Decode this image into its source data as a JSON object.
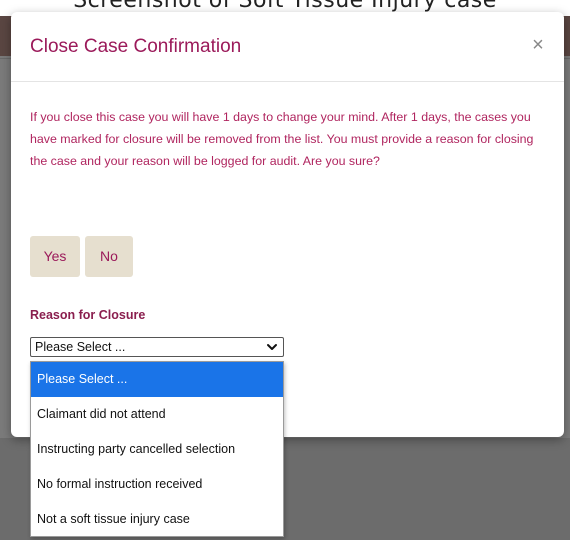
{
  "background": {
    "caption": "Screenshot of Soft Tissue Injury case"
  },
  "modal": {
    "title": "Close Case Confirmation",
    "close_symbol": "×",
    "message": "If you close this case you will have 1 days to change your mind. After 1 days, the cases you have marked for closure will be removed from the list. You must provide a reason for closing the case and your reason will be logged for audit. Are you sure?",
    "yes_label": "Yes",
    "no_label": "No",
    "reason_label": "Reason for Closure",
    "select": {
      "value": "Please Select ...",
      "icon": "chevron-down-icon"
    },
    "options": [
      {
        "label": "Please Select ...",
        "selected": true
      },
      {
        "label": "Claimant did not attend",
        "selected": false
      },
      {
        "label": "Instructing party cancelled selection",
        "selected": false
      },
      {
        "label": "No formal instruction received",
        "selected": false
      },
      {
        "label": "Not a soft tissue injury case",
        "selected": false
      }
    ]
  },
  "colors": {
    "accent": "#9b1a5a",
    "message_text": "#b0255f",
    "button_bg": "#e6dfcf",
    "option_highlight": "#1a74e8",
    "overlay": "#7b7b7b",
    "header_bar": "#5a4642"
  }
}
